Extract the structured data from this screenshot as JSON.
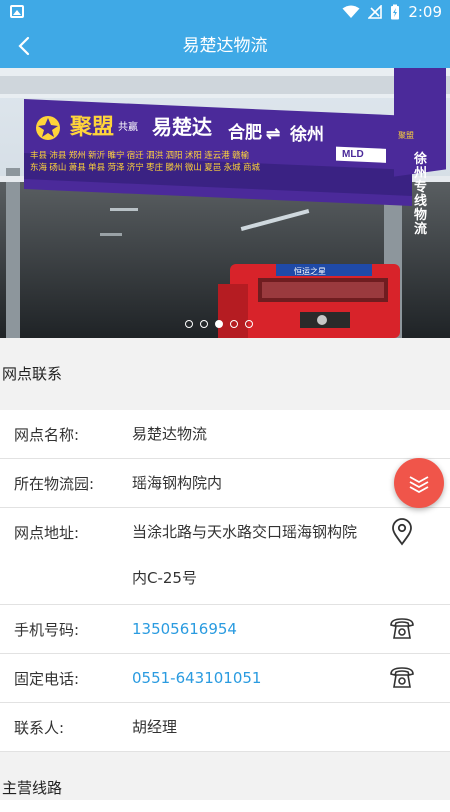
{
  "status_bar": {
    "time": "2:09"
  },
  "header": {
    "title": "易楚达物流",
    "back_icon": "chevron-left-icon"
  },
  "banner": {
    "sign": {
      "brand": "聚盟",
      "brand_side": "共赢",
      "company": "易楚达",
      "route_from": "合肥",
      "route_to": "徐州",
      "logo_text": "MLD",
      "cities_row1": [
        "丰县",
        "沛县",
        "郑州",
        "新沂",
        "睢宁",
        "宿迁",
        "泗洪",
        "泗阳",
        "沭阳",
        "连云港",
        "赣榆"
      ],
      "cities_row2": [
        "东海",
        "砀山",
        "萧县",
        "单县",
        "菏泽",
        "济宁",
        "枣庄",
        "滕州",
        "微山",
        "夏邑",
        "永城",
        "商城"
      ],
      "side_sign": "徐州专线物流",
      "side_brand": "聚盟",
      "truck_plate": "恒运之星"
    },
    "slides": 5,
    "active_slide": 2
  },
  "section_contact": {
    "title": "网点联系"
  },
  "contact_rows": [
    {
      "label": "网点名称:",
      "value": "易楚达物流"
    },
    {
      "label": "所在物流园:",
      "value": "瑶海钢构院内"
    },
    {
      "label": "网点地址:",
      "value_line1": "当涂北路与天水路交口瑶海钢构院",
      "value_line2": "内C-25号",
      "icon": "location-pin-icon"
    },
    {
      "label": "手机号码:",
      "value": "13505616954",
      "icon": "phone-icon"
    },
    {
      "label": "固定电话:",
      "value": "0551-643101051",
      "icon": "phone-icon"
    },
    {
      "label": "联系人:",
      "value": "胡经理"
    }
  ],
  "section_routes": {
    "title": "主营线路"
  },
  "colors": {
    "primary": "#3fa9e6",
    "link": "#2a9be0",
    "fab": "#f0554a",
    "sign_bg": "#4b2a9a"
  },
  "fab_icon": "layers-chevrons-icon"
}
